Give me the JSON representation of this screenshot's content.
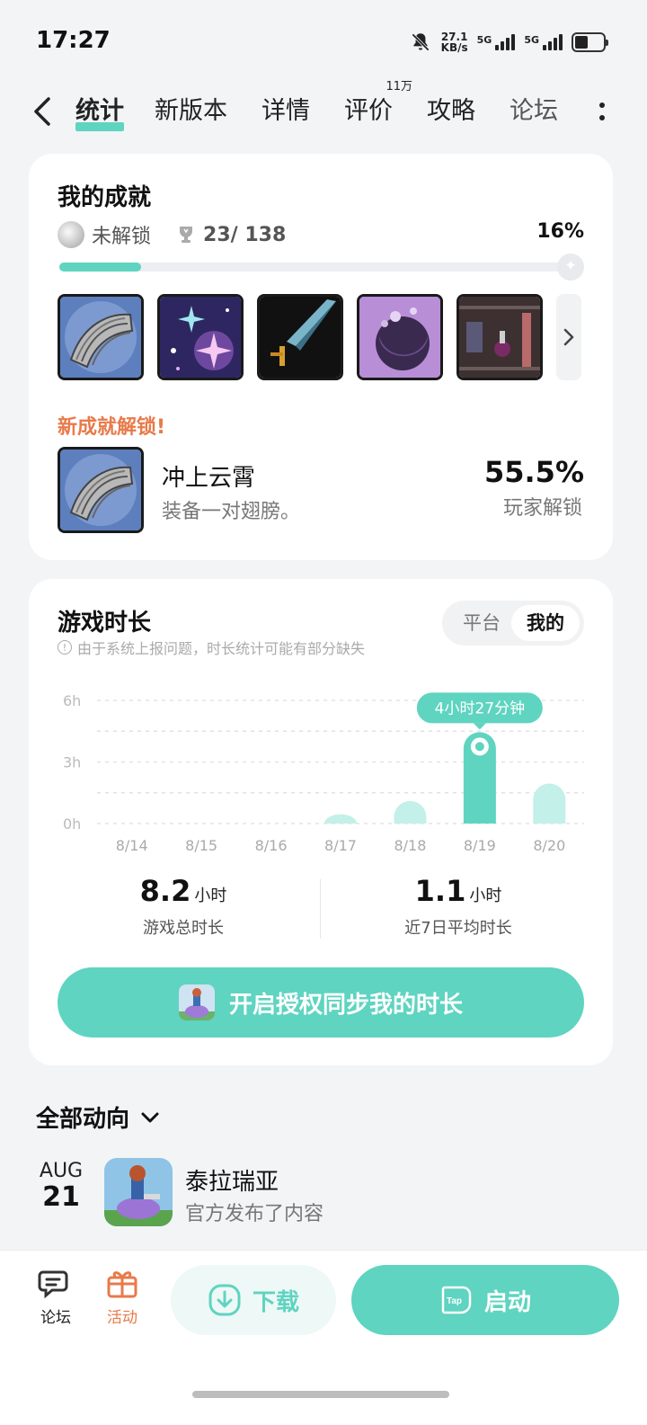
{
  "status_bar": {
    "time": "17:27",
    "speed_value": "27.1",
    "speed_unit": "KB/s",
    "sim1": "5G",
    "sim2": "5G"
  },
  "nav": {
    "tabs": [
      {
        "label": "统计",
        "active": true
      },
      {
        "label": "新版本"
      },
      {
        "label": "详情"
      },
      {
        "label": "评价",
        "badge": "11万"
      },
      {
        "label": "攻略"
      },
      {
        "label": "论坛"
      }
    ]
  },
  "achievements": {
    "title": "我的成就",
    "locked_label": "未解锁",
    "count": "23/ 138",
    "percent_label": "16%",
    "progress": 0.16,
    "new_unlock_label": "新成就解锁!",
    "new_name": "冲上云霄",
    "new_desc": "装备一对翅膀。",
    "new_percent": "55.5%",
    "new_percent_label": "玩家解锁"
  },
  "playtime": {
    "title": "游戏时长",
    "note": "由于系统上报问题，时长统计可能有部分缺失",
    "toggle_platform": "平台",
    "toggle_mine": "我的",
    "total_value": "8.2",
    "total_unit": "小时",
    "total_label": "游戏总时长",
    "avg_value": "1.1",
    "avg_unit": "小时",
    "avg_label": "近7日平均时长",
    "sync_button": "开启授权同步我的时长"
  },
  "chart_data": {
    "type": "bar",
    "categories": [
      "8/14",
      "8/15",
      "8/16",
      "8/17",
      "8/18",
      "8/19",
      "8/20"
    ],
    "values": [
      0,
      0,
      0,
      0.45,
      1.1,
      4.45,
      1.95
    ],
    "highlight_index": 5,
    "highlight_label": "4小时27分钟",
    "y_ticks": [
      "0h",
      "3h",
      "6h"
    ],
    "ylim": [
      0,
      6
    ],
    "colors": {
      "bar": "#c3f0e8",
      "highlight": "#5fd4c0"
    }
  },
  "trends": {
    "title": "全部动向",
    "month": "AUG",
    "day": "21",
    "game_name": "泰拉瑞亚",
    "subtitle": "官方发布了内容"
  },
  "bottom_bar": {
    "forum_label": "论坛",
    "activity_label": "活动",
    "download_label": "下载",
    "start_label": "启动",
    "start_icon_text": "Tap"
  }
}
